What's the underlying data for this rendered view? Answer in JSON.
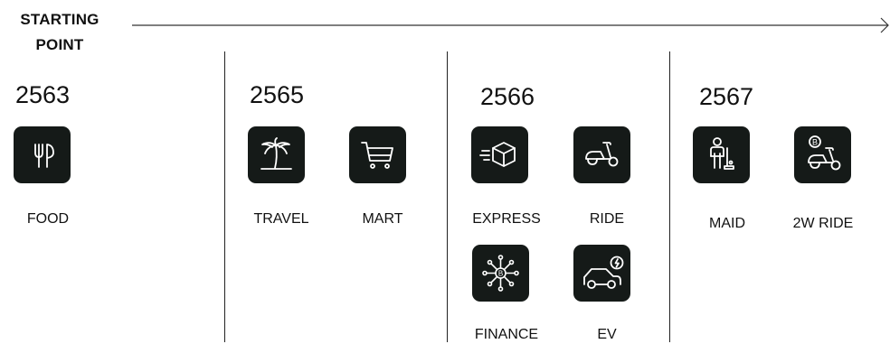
{
  "start": {
    "line1": "STARTING",
    "line2": "POINT"
  },
  "accent_color": "#151a18",
  "periods": [
    {
      "year": "2563",
      "services": [
        {
          "label": "FOOD",
          "icon": "utensils-icon"
        }
      ]
    },
    {
      "year": "2565",
      "services": [
        {
          "label": "TRAVEL",
          "icon": "palm-tree-icon"
        },
        {
          "label": "MART",
          "icon": "shopping-cart-icon"
        }
      ]
    },
    {
      "year": "2566",
      "services": [
        {
          "label": "EXPRESS",
          "icon": "parcel-box-icon"
        },
        {
          "label": "RIDE",
          "icon": "scooter-icon"
        },
        {
          "label": "FINANCE",
          "icon": "finance-network-icon"
        },
        {
          "label": "EV",
          "icon": "electric-car-icon"
        }
      ]
    },
    {
      "year": "2567",
      "services": [
        {
          "label": "MAID",
          "icon": "maid-cleaner-icon"
        },
        {
          "label": "2W RIDE",
          "icon": "two-wheel-scooter-icon"
        }
      ]
    }
  ]
}
